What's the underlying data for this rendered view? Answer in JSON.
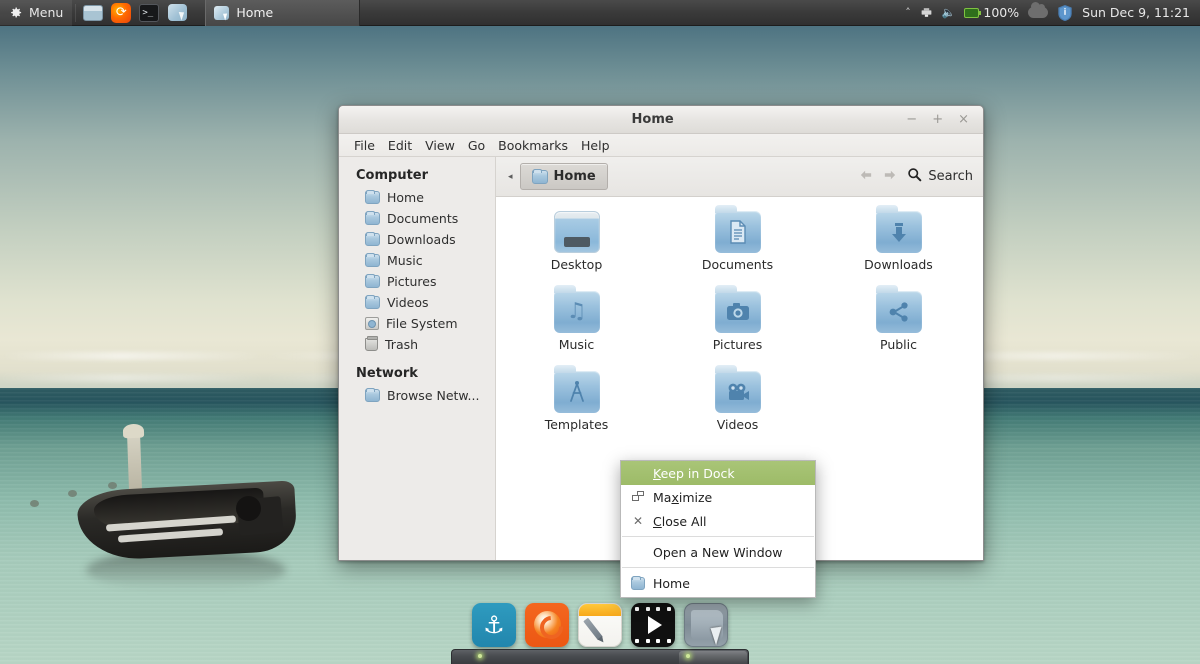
{
  "panel": {
    "menu_label": "Menu",
    "menu_icon": "gear-icon",
    "launchers": [
      {
        "name": "show-desktop-icon",
        "label": "Show Desktop"
      },
      {
        "name": "firefox-icon",
        "label": "Firefox Web Browser"
      },
      {
        "name": "terminal-icon",
        "label": "Terminal"
      },
      {
        "name": "file-manager-icon",
        "label": "Files"
      }
    ],
    "window_list": [
      {
        "title": "Home",
        "icon": "file-manager-icon",
        "active": true
      }
    ],
    "tray": {
      "chevron": "˄",
      "network_icon": "network-icon",
      "volume_icon": "volume-icon",
      "battery_label": "100%",
      "weather_icon": "cloud-icon",
      "update_icon": "shield-icon",
      "clock": "Sun Dec  9, 11:21"
    }
  },
  "window": {
    "title": "Home",
    "controls": {
      "minimize": "−",
      "maximize": "+",
      "close": "×"
    },
    "menubar": [
      "File",
      "Edit",
      "View",
      "Go",
      "Bookmarks",
      "Help"
    ],
    "sidebar": {
      "sections": [
        {
          "header": "Computer",
          "items": [
            {
              "label": "Home",
              "icon": "folder-icon"
            },
            {
              "label": "Documents",
              "icon": "folder-icon"
            },
            {
              "label": "Downloads",
              "icon": "folder-icon"
            },
            {
              "label": "Music",
              "icon": "folder-icon"
            },
            {
              "label": "Pictures",
              "icon": "folder-icon"
            },
            {
              "label": "Videos",
              "icon": "folder-icon"
            },
            {
              "label": "File System",
              "icon": "disc-icon"
            },
            {
              "label": "Trash",
              "icon": "trash-icon"
            }
          ]
        },
        {
          "header": "Network",
          "items": [
            {
              "label": "Browse Netw...",
              "icon": "folder-icon"
            }
          ]
        }
      ]
    },
    "pathbar": {
      "prev_arrow": "◂",
      "breadcrumb": "Home",
      "back_arrow": "←",
      "forward_arrow": "→",
      "search_label": "Search",
      "search_icon": "search-icon"
    },
    "files": [
      {
        "label": "Desktop",
        "icon": "desktop-folder-icon",
        "glyph": ""
      },
      {
        "label": "Documents",
        "icon": "documents-folder-icon",
        "glyph": "🗎"
      },
      {
        "label": "Downloads",
        "icon": "downloads-folder-icon",
        "glyph": "⬇"
      },
      {
        "label": "Music",
        "icon": "music-folder-icon",
        "glyph": "♫"
      },
      {
        "label": "Pictures",
        "icon": "pictures-folder-icon",
        "glyph": "📷"
      },
      {
        "label": "Public",
        "icon": "public-folder-icon",
        "glyph": "⑂"
      },
      {
        "label": "Templates",
        "icon": "templates-folder-icon",
        "glyph": "△"
      },
      {
        "label": "Videos",
        "icon": "videos-folder-icon",
        "glyph": "🎥"
      }
    ]
  },
  "context_menu": {
    "highlight_color": "#a3bf6f",
    "items": [
      {
        "label": "Keep in Dock",
        "mnemonic": "K",
        "highlighted": true,
        "icon": ""
      },
      {
        "label": "Maximize",
        "mnemonic": "x",
        "highlighted": false,
        "icon": "maximize-icon"
      },
      {
        "label": "Close All",
        "mnemonic": "C",
        "highlighted": false,
        "icon": "close-icon"
      },
      {
        "label": "Open a New Window",
        "mnemonic": "",
        "highlighted": false,
        "icon": ""
      },
      {
        "label": "Home",
        "mnemonic": "",
        "highlighted": false,
        "icon": "folder-icon"
      }
    ]
  },
  "dock": {
    "items": [
      {
        "name": "docky-anchor-icon",
        "label": "Docky"
      },
      {
        "name": "firefox-icon",
        "label": "Firefox"
      },
      {
        "name": "text-editor-icon",
        "label": "Text Editor"
      },
      {
        "name": "media-player-icon",
        "label": "Media Player"
      },
      {
        "name": "file-manager-icon",
        "label": "Files",
        "active": true
      }
    ]
  }
}
